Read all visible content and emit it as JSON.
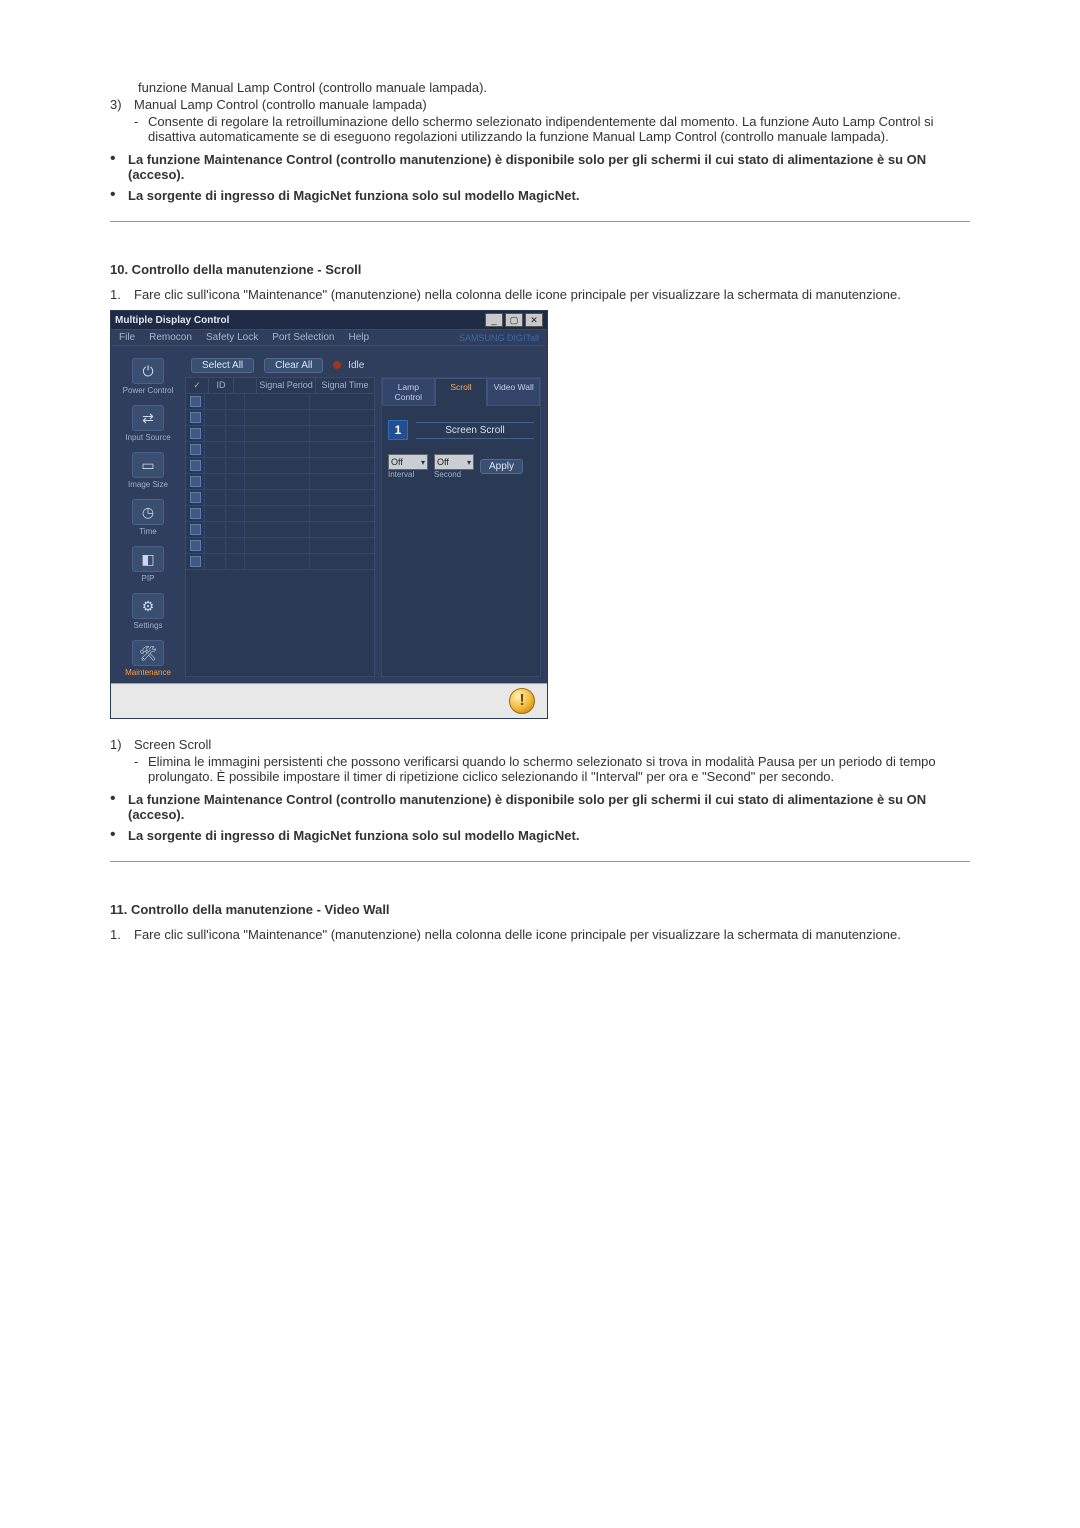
{
  "intro": {
    "line0": "funzione Manual Lamp Control (controllo manuale lampada).",
    "item3_num": "3)",
    "item3_label": "Manual Lamp Control (controllo manuale lampada)",
    "item3_dash": "-",
    "item3_desc": "Consente di regolare la retroilluminazione dello schermo selezionato indipendentemente dal momento. La funzione Auto Lamp Control si disattiva automaticamente se di eseguono regolazioni utilizzando la funzione Manual Lamp Control (controllo manuale lampada).",
    "bullet1": "La funzione Maintenance Control (controllo manutenzione) è disponibile solo per gli schermi il cui stato di alimentazione è su ON (acceso).",
    "bullet2": "La sorgente di ingresso di MagicNet funziona solo sul modello MagicNet."
  },
  "section10": {
    "title": "10. Controllo della manutenzione - Scroll",
    "step1_num": "1.",
    "step1_text": "Fare clic sull'icona \"Maintenance\" (manutenzione) nella colonna delle icone principale per visualizzare la schermata di manutenzione."
  },
  "app": {
    "title": "Multiple Display Control",
    "menu": [
      "File",
      "Remocon",
      "Safety Lock",
      "Port Selection",
      "Help"
    ],
    "brand": "SAMSUNG DIGITall",
    "buttons": {
      "select_all": "Select All",
      "clear_all": "Clear All"
    },
    "idle": "Idle",
    "sidebar": [
      {
        "label": "Power Control"
      },
      {
        "label": "Input Source"
      },
      {
        "label": "Image Size"
      },
      {
        "label": "Time"
      },
      {
        "label": "PIP"
      },
      {
        "label": "Settings"
      },
      {
        "label": "Maintenance"
      }
    ],
    "table_headers": {
      "chk": "✓",
      "id": "ID",
      "flag": "",
      "signal_period": "Signal Period",
      "signal_time": "Signal Time"
    },
    "tabs": {
      "lamp": "Lamp Control",
      "scroll": "Scroll",
      "video": "Video Wall"
    },
    "panel": {
      "badge": "1",
      "heading": "Screen Scroll",
      "interval_value": "Off",
      "second_value": "Off",
      "interval_label": "Interval",
      "second_label": "Second",
      "apply": "Apply"
    },
    "warn_glyph": "!"
  },
  "after_figure": {
    "item1_num": "1)",
    "item1_label": "Screen Scroll",
    "item1_dash": "-",
    "item1_desc": "Elimina le immagini persistenti che possono verificarsi quando lo schermo selezionato si trova in modalità Pausa per un periodo di tempo prolungato. È possibile impostare il timer di ripetizione ciclico selezionando il \"Interval\" per ora e \"Second\" per secondo.",
    "bullet1": "La funzione Maintenance Control (controllo manutenzione) è disponibile solo per gli schermi il cui stato di alimentazione è su ON (acceso).",
    "bullet2": "La sorgente di ingresso di MagicNet funziona solo sul modello MagicNet."
  },
  "section11": {
    "title": "11. Controllo della manutenzione - Video Wall",
    "step1_num": "1.",
    "step1_text": "Fare clic sull'icona \"Maintenance\" (manutenzione) nella colonna delle icone principale per visualizzare la schermata di manutenzione."
  },
  "bullet_glyph": "•"
}
